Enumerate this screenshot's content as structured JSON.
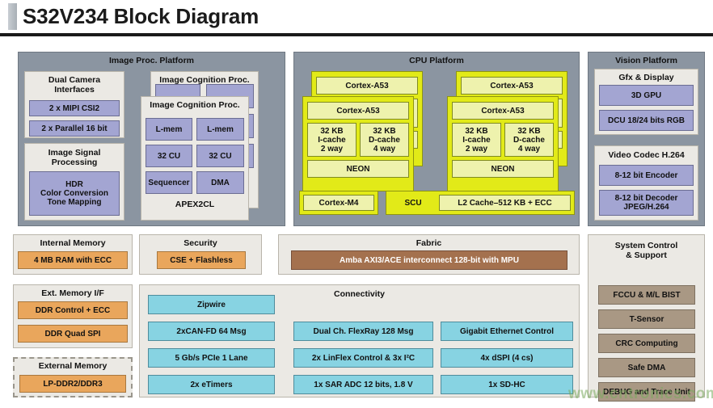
{
  "title": "S32V234 Block Diagram",
  "watermark": "www.cntronics.com",
  "image_proc_platform": {
    "heading": "Image Proc. Platform",
    "dual_camera": {
      "heading_line1": "Dual Camera",
      "heading_line2": "Interfaces",
      "items": [
        "2 x MIPI CSI2",
        "2 x Parallel 16 bit"
      ]
    },
    "isp": {
      "heading_line1": "Image Signal",
      "heading_line2": "Processing",
      "item": "HDR\nColor Conversion\nTone Mapping",
      "item_line1": "HDR",
      "item_line2": "Color Conversion",
      "item_line3": "Tone Mapping"
    },
    "apex_back": {
      "heading": "Image Cognition Proc."
    },
    "apex_front": {
      "heading": "Image Cognition Proc.",
      "cells": [
        "L-mem",
        "L-mem",
        "32 CU",
        "32 CU",
        "Sequencer",
        "DMA"
      ],
      "footer": "APEX2CL"
    }
  },
  "cpu_platform": {
    "heading": "CPU Platform",
    "cluster_left": {
      "back_label": "Cortex-A53",
      "front_label": "Cortex-A53",
      "icache_line1": "32 KB",
      "icache_line2": "I-cache",
      "icache_line3": "2 way",
      "dcache_line1": "32 KB",
      "dcache_line2": "D-cache",
      "dcache_line3": "4 way",
      "neon": "NEON"
    },
    "cluster_right": {
      "back_label": "Cortex-A53",
      "front_label": "Cortex-A53",
      "icache_line1": "32 KB",
      "icache_line2": "I-cache",
      "icache_line3": "2 way",
      "dcache_line1": "32 KB",
      "dcache_line2": "D-cache",
      "dcache_line3": "4 way",
      "neon": "NEON"
    },
    "cortex_m4": "Cortex-M4",
    "scu": "SCU",
    "l2_cache": "L2 Cache–512 KB + ECC"
  },
  "vision_platform": {
    "heading": "Vision Platform",
    "gfx": {
      "heading": "Gfx & Display",
      "items": [
        "3D GPU",
        "DCU 18/24 bits RGB"
      ]
    },
    "codec": {
      "heading": "Video Codec H.264",
      "items": [
        "8-12 bit Encoder",
        "8-12 bit Decoder JPEG/H.264"
      ],
      "decoder_line1": "8-12 bit Decoder",
      "decoder_line2": "JPEG/H.264"
    }
  },
  "internal_memory": {
    "heading": "Internal Memory",
    "items": [
      "4 MB RAM with ECC"
    ]
  },
  "security": {
    "heading": "Security",
    "items": [
      "CSE + Flashless"
    ]
  },
  "fabric": {
    "heading": "Fabric",
    "items": [
      "Amba AXI3/ACE interconnect 128-bit with MPU"
    ]
  },
  "ext_memory_if": {
    "heading": "Ext. Memory I/F",
    "items": [
      "DDR Control + ECC",
      "DDR Quad SPI"
    ]
  },
  "external_memory": {
    "heading": "External Memory",
    "items": [
      "LP-DDR2/DDR3"
    ]
  },
  "connectivity": {
    "heading": "Connectivity",
    "col1": [
      "Zipwire",
      "2xCAN-FD 64 Msg",
      "5 Gb/s PCIe 1 Lane",
      "2x eTimers"
    ],
    "col2": [
      "Dual Ch. FlexRay 128 Msg",
      "2x LinFlex Control & 3x I²C",
      "1x SAR ADC 12 bits, 1.8 V"
    ],
    "col3": [
      "Gigabit Ethernet Control",
      "4x dSPI (4 cs)",
      "1x SD-HC"
    ]
  },
  "system_control": {
    "heading_line1": "System Control",
    "heading_line2": "& Support",
    "items": [
      "FCCU & M/L BIST",
      "T-Sensor",
      "CRC Computing",
      "Safe DMA",
      "DEBUG and Trace Unit"
    ]
  }
}
